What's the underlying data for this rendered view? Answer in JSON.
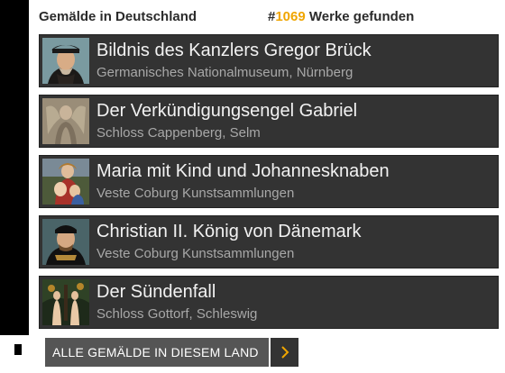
{
  "header": {
    "title": "Gemälde in Deutschland",
    "count_prefix": "#",
    "count": "1069",
    "count_suffix": " Werke gefunden"
  },
  "colors": {
    "accent": "#f0a500",
    "item_bg": "#333333",
    "button_bg": "#555555"
  },
  "items": [
    {
      "title": "Bildnis des Kanzlers Gregor Brück",
      "location": "Germanisches Nationalmuseum, Nürnberg",
      "thumb": "portrait-man-hat-thumbnail"
    },
    {
      "title": "Der Verkündigungsengel Gabriel",
      "location": "Schloss Cappenberg, Selm",
      "thumb": "angel-thumbnail"
    },
    {
      "title": "Maria mit Kind und Johannesknaben",
      "location": "Veste Coburg Kunstsammlungen",
      "thumb": "madonna-child-thumbnail"
    },
    {
      "title": "Christian II. König von Dänemark",
      "location": "Veste Coburg Kunstsammlungen",
      "thumb": "portrait-king-thumbnail"
    },
    {
      "title": "Der Sündenfall",
      "location": "Schloss Gottorf, Schleswig",
      "thumb": "adam-eve-thumbnail"
    }
  ],
  "footer": {
    "all_button_label": "ALLE GEMÄLDE IN DIESEM LAND",
    "arrow_icon": "chevron-right-icon"
  }
}
